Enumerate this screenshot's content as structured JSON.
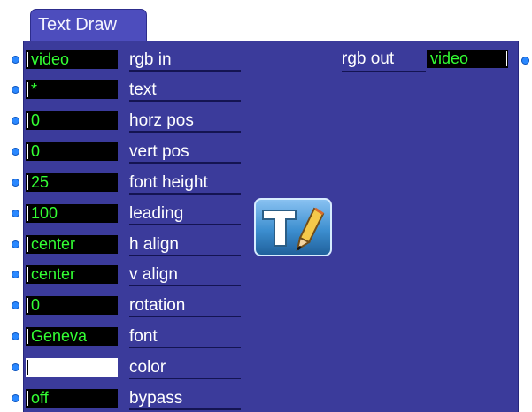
{
  "actor": {
    "title": "Text Draw"
  },
  "inputs": [
    {
      "value": "video",
      "label": "rgb in"
    },
    {
      "value": "*",
      "label": "text"
    },
    {
      "value": "0",
      "label": "horz pos"
    },
    {
      "value": "0",
      "label": "vert pos"
    },
    {
      "value": "25",
      "label": "font height"
    },
    {
      "value": "100",
      "label": "leading"
    },
    {
      "value": "center",
      "label": "h align"
    },
    {
      "value": "center",
      "label": "v align"
    },
    {
      "value": "0",
      "label": "rotation"
    },
    {
      "value": "Geneva",
      "label": "font"
    },
    {
      "value": "",
      "label": "color"
    },
    {
      "value": "off",
      "label": "bypass"
    }
  ],
  "output": {
    "label": "rgb out",
    "value": "video"
  },
  "icons": {
    "port": "port-dot-icon",
    "actor": "text-draw-icon"
  },
  "colors": {
    "panel": "#3b3b9b",
    "tab": "#4d4dbd",
    "port": "#2a88ff",
    "value_text": "#33ff33",
    "color_swatch": "#ffffff"
  }
}
